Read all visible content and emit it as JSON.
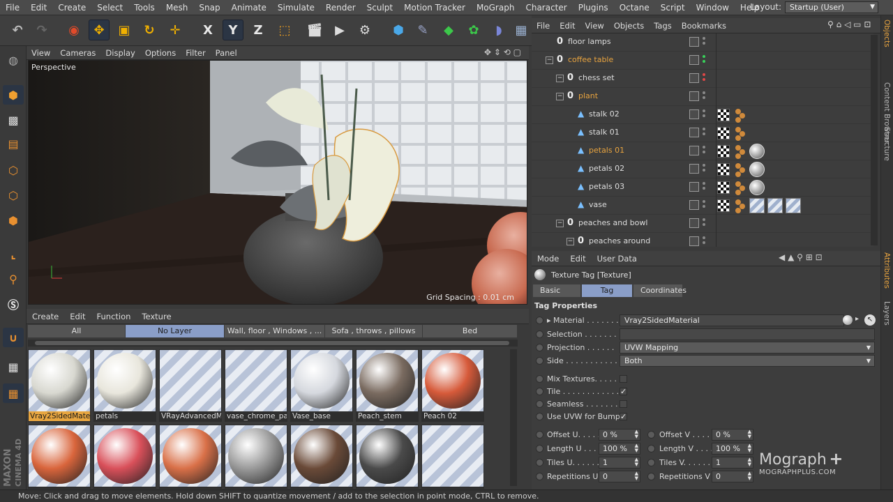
{
  "menubar": {
    "items": [
      "File",
      "Edit",
      "Create",
      "Select",
      "Tools",
      "Mesh",
      "Snap",
      "Animate",
      "Simulate",
      "Render",
      "Sculpt",
      "Motion Tracker",
      "MoGraph",
      "Character",
      "Plugins",
      "Octane",
      "Script",
      "Window",
      "Help"
    ],
    "layout_label": "Layout:",
    "layout_value": "Startup (User)"
  },
  "toolbar": {
    "x_label": "X",
    "y_label": "Y",
    "z_label": "Z"
  },
  "viewport": {
    "menu": [
      "View",
      "Cameras",
      "Display",
      "Options",
      "Filter",
      "Panel"
    ],
    "camera_label": "Perspective",
    "grid_spacing": "Grid Spacing : 0.01 cm"
  },
  "material_manager": {
    "menu": [
      "Create",
      "Edit",
      "Function",
      "Texture"
    ],
    "layer_tabs": [
      "All",
      "No Layer",
      "Wall, floor , Windows , ...",
      "Sofa , throws , pillows",
      "Bed"
    ],
    "materials": [
      {
        "name": "Vray2SidedMater",
        "selected": true,
        "color": "#d8d8d0"
      },
      {
        "name": "petals",
        "color": "#e8e6dc"
      },
      {
        "name": "VRayAdvancedM",
        "color": "none"
      },
      {
        "name": "vase_chrome_pat",
        "color": "none"
      },
      {
        "name": "Vase_base",
        "color": "#d5d8de"
      },
      {
        "name": "Peach_stem",
        "color": "#7a6b60"
      },
      {
        "name": "Peach 02",
        "color": "#d65a3a"
      },
      {
        "name": "",
        "color": "#d9653c"
      },
      {
        "name": "",
        "color": "#d9505a"
      },
      {
        "name": "",
        "color": "#d97048"
      },
      {
        "name": "",
        "color": "#9a9a9a"
      },
      {
        "name": "",
        "color": "#6a4a38"
      },
      {
        "name": "",
        "color": "#4a4a4a"
      },
      {
        "name": "",
        "color": "none"
      }
    ]
  },
  "object_manager": {
    "menu": [
      "File",
      "Edit",
      "View",
      "Objects",
      "Tags",
      "Bookmarks"
    ],
    "rows": [
      {
        "name": "floor lamps",
        "highlight": false,
        "dot": "none",
        "tags": []
      },
      {
        "name": "coffee table",
        "highlight": true,
        "dot": "green",
        "tags": []
      },
      {
        "name": "chess set",
        "highlight": false,
        "dot": "red",
        "tags": []
      },
      {
        "name": "plant",
        "highlight": true,
        "dot": "none",
        "tags": []
      },
      {
        "name": "stalk 02",
        "highlight": false,
        "dot": "none",
        "tags": [
          "checker",
          "balls"
        ]
      },
      {
        "name": "stalk 01",
        "highlight": false,
        "dot": "none",
        "tags": [
          "checker",
          "balls"
        ]
      },
      {
        "name": "petals 01",
        "highlight": true,
        "dot": "none",
        "tags": [
          "checker",
          "balls",
          "sphere"
        ]
      },
      {
        "name": "petals 02",
        "highlight": false,
        "dot": "none",
        "tags": [
          "checker",
          "balls",
          "sphere"
        ]
      },
      {
        "name": "petals 03",
        "highlight": false,
        "dot": "none",
        "tags": [
          "checker",
          "balls",
          "sphere"
        ]
      },
      {
        "name": "vase",
        "highlight": false,
        "dot": "none",
        "tags": [
          "checker",
          "balls",
          "tex",
          "tex",
          "tex"
        ]
      },
      {
        "name": "peaches and bowl",
        "highlight": false,
        "dot": "none",
        "tags": []
      },
      {
        "name": "peaches around",
        "highlight": false,
        "dot": "none",
        "tags": []
      }
    ]
  },
  "side_tabs": [
    "Objects",
    "Content Browser",
    "Structure",
    "Attributes",
    "Layers"
  ],
  "attributes": {
    "menu": [
      "Mode",
      "Edit",
      "User Data"
    ],
    "title": "Texture Tag [Texture]",
    "tabs": [
      "Basic",
      "Tag",
      "Coordinates"
    ],
    "section": "Tag Properties",
    "material_label": "Material . . . . . . .",
    "material_value": "Vray2SidedMaterial",
    "selection_label": "Selection . . . . . . .",
    "selection_value": "",
    "projection_label": "Projection . . . . . .",
    "projection_value": "UVW Mapping",
    "side_label": "Side . . . . . . . . . . .",
    "side_value": "Both",
    "mix_label": "Mix Textures. . . . . .",
    "mix_checked": false,
    "tile_label": "Tile . . . . . . . . . . . .",
    "tile_checked": true,
    "seamless_label": "Seamless . . . . . . . .",
    "seamless_checked": false,
    "uvw_label": "Use UVW for Bump",
    "uvw_checked": true,
    "offset_u_label": "Offset U. . . . . . .",
    "offset_u": "0 %",
    "offset_v_label": "Offset V . . . . . . .",
    "offset_v": "0 %",
    "length_u_label": "Length U . . . . . .",
    "length_u": "100 %",
    "length_v_label": "Length V . . . . . .",
    "length_v": "100 %",
    "tiles_u_label": "Tiles U. . . . . . . .",
    "tiles_u": "1",
    "tiles_v_label": "Tiles V. . . . . . . .",
    "tiles_v": "1",
    "rep_u_label": "Repetitions U",
    "rep_u": "0",
    "rep_v_label": "Repetitions V",
    "rep_v": "0"
  },
  "watermark": {
    "text": "Mograph",
    "plus": "+",
    "sub": "MOGRAPHPLUS.COM"
  },
  "maxon": {
    "line1": "MAXON",
    "line2": "CINEMA 4D"
  },
  "status": "Move: Click and drag to move elements. Hold down SHIFT to quantize movement / add to the selection in point mode, CTRL to remove."
}
